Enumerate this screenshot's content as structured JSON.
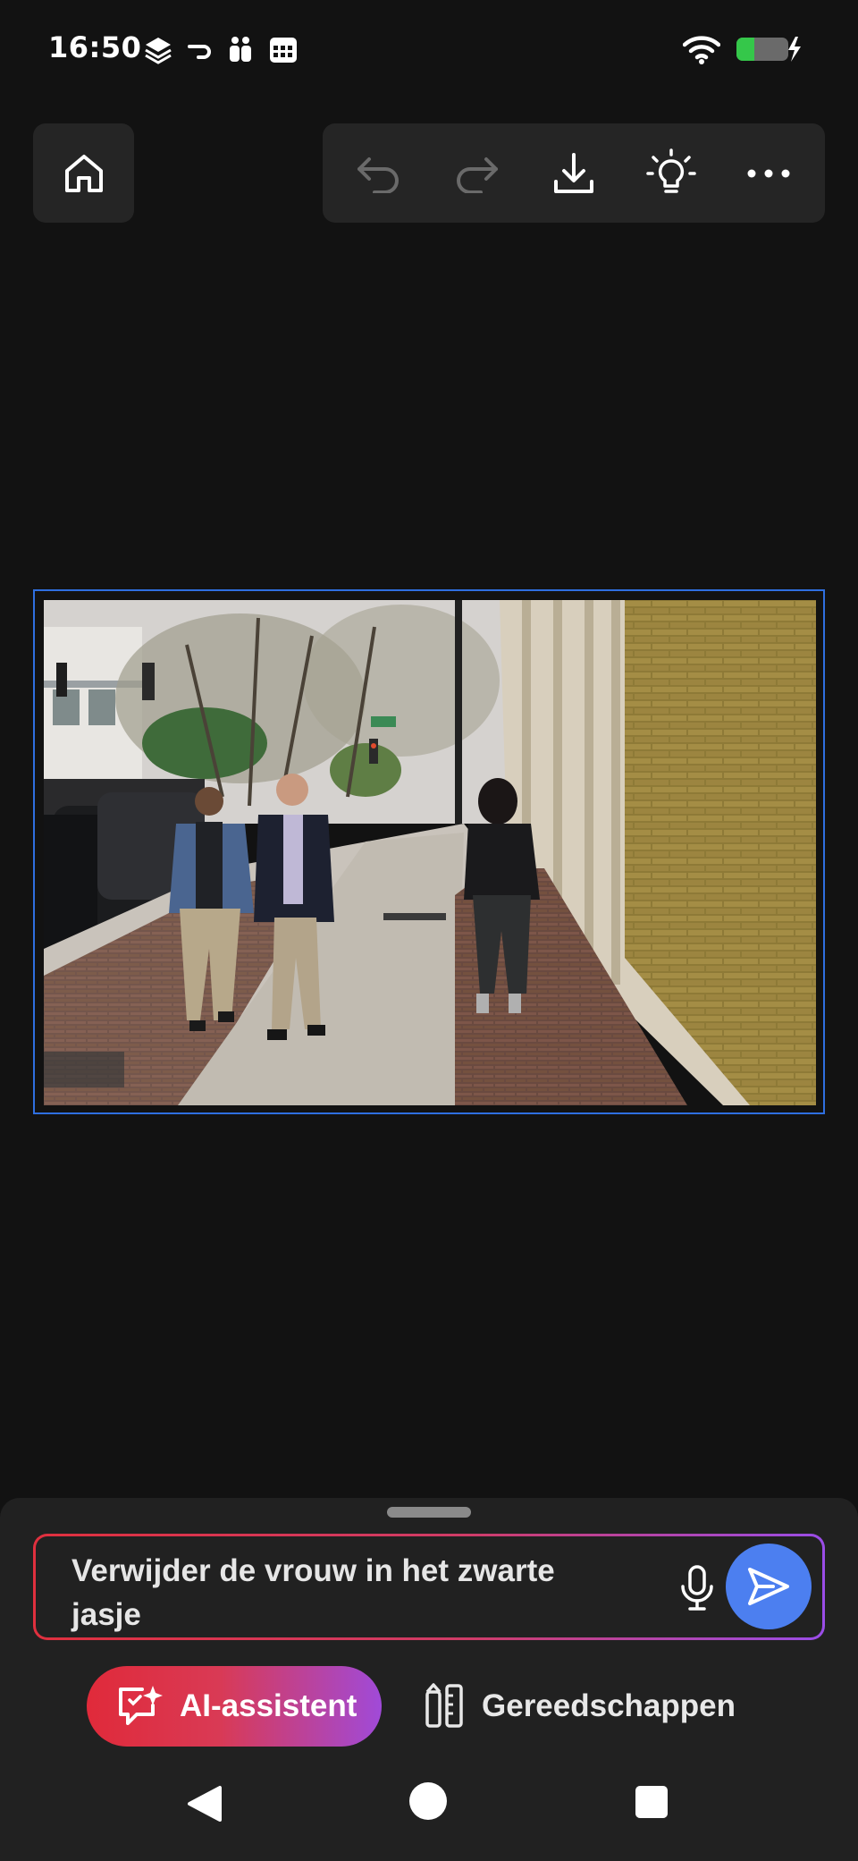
{
  "status_bar": {
    "time": "16:50",
    "left_icons": [
      "layers-icon",
      "link-icon",
      "people-icon",
      "calendar-icon"
    ],
    "right_icons": [
      "wifi-icon",
      "battery-charging-icon"
    ]
  },
  "toolbar": {
    "home_icon": "home-icon",
    "actions": [
      "undo-icon",
      "redo-icon",
      "download-icon",
      "lightbulb-icon",
      "more-icon"
    ]
  },
  "canvas": {
    "image": "street-photo",
    "selection_color": "#2f6fe0"
  },
  "prompt": {
    "value": "Verwijder de vrouw in het zwarte jasje",
    "mic_icon": "microphone-icon",
    "send_icon": "send-icon"
  },
  "bottom_tabs": {
    "ai_assistant_label": "AI-assistent",
    "tools_label": "Gereedschappen"
  },
  "colors": {
    "accent_blue": "#4c7ff0",
    "gradient_start": "#e02a3a",
    "gradient_end": "#a04ad8"
  }
}
